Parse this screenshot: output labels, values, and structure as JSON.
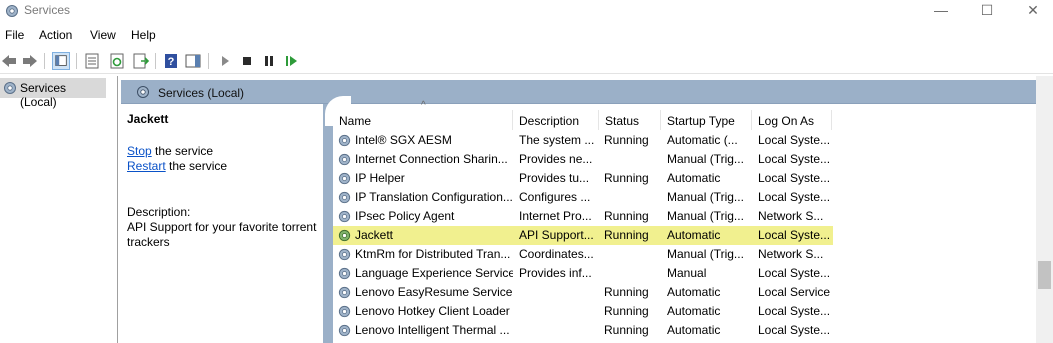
{
  "window": {
    "title": "Services"
  },
  "menu": [
    "File",
    "Action",
    "View",
    "Help"
  ],
  "toolbar": {
    "icons": [
      "back-icon",
      "forward-icon",
      "show-hide-console-tree-icon",
      "properties-icon",
      "refresh-icon",
      "export-list-icon",
      "help-icon",
      "show-hide-action-pane-icon",
      "start-service-icon",
      "stop-service-icon",
      "pause-service-icon",
      "restart-service-icon"
    ]
  },
  "tree": {
    "item": "Services (Local)"
  },
  "pane": {
    "header": "Services (Local)",
    "selected_service": "Jackett",
    "stop_link": "Stop",
    "stop_suffix": " the service",
    "restart_link": "Restart",
    "restart_suffix": " the service",
    "description_label": "Description:",
    "description": "API Support for your favorite torrent trackers"
  },
  "columns": [
    "Name",
    "Description",
    "Status",
    "Startup Type",
    "Log On As"
  ],
  "sort_indicator": "^",
  "rows": [
    {
      "name": "Intel® SGX AESM",
      "desc": "The system ...",
      "status": "Running",
      "startup": "Automatic (...",
      "logon": "Local Syste..."
    },
    {
      "name": "Internet Connection Sharin...",
      "desc": "Provides ne...",
      "status": "",
      "startup": "Manual (Trig...",
      "logon": "Local Syste..."
    },
    {
      "name": "IP Helper",
      "desc": "Provides tu...",
      "status": "Running",
      "startup": "Automatic",
      "logon": "Local Syste..."
    },
    {
      "name": "IP Translation Configuration...",
      "desc": "Configures ...",
      "status": "",
      "startup": "Manual (Trig...",
      "logon": "Local Syste..."
    },
    {
      "name": "IPsec Policy Agent",
      "desc": "Internet Pro...",
      "status": "Running",
      "startup": "Manual (Trig...",
      "logon": "Network S..."
    },
    {
      "name": "Jackett",
      "desc": "API Support...",
      "status": "Running",
      "startup": "Automatic",
      "logon": "Local Syste..."
    },
    {
      "name": "KtmRm for Distributed Tran...",
      "desc": "Coordinates...",
      "status": "",
      "startup": "Manual (Trig...",
      "logon": "Network S..."
    },
    {
      "name": "Language Experience Service",
      "desc": "Provides inf...",
      "status": "",
      "startup": "Manual",
      "logon": "Local Syste..."
    },
    {
      "name": "Lenovo EasyResume Service",
      "desc": "",
      "status": "Running",
      "startup": "Automatic",
      "logon": "Local Service"
    },
    {
      "name": "Lenovo Hotkey Client Loader",
      "desc": "",
      "status": "Running",
      "startup": "Automatic",
      "logon": "Local Syste..."
    },
    {
      "name": "Lenovo Intelligent Thermal ...",
      "desc": "",
      "status": "Running",
      "startup": "Automatic",
      "logon": "Local Syste..."
    }
  ],
  "selected_row": 5,
  "colors": {
    "header_blue": "#9bb0c8",
    "selection": "#f1f08f",
    "link": "#0a52c8"
  }
}
